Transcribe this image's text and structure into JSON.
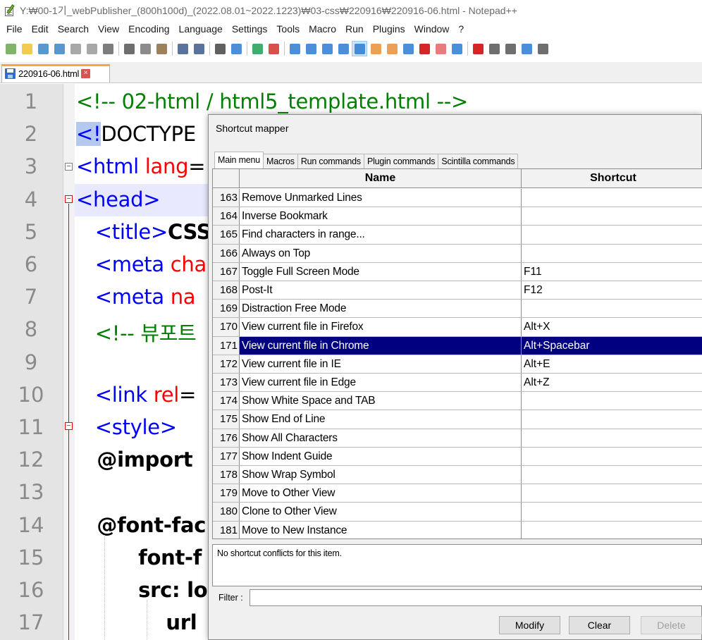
{
  "window": {
    "title": "Y:₩00-1기_webPublisher_(800h100d)_(2022.08.01~2022.1223)₩03-css₩220916₩220916-06.html - Notepad++"
  },
  "menubar": {
    "items": [
      "File",
      "Edit",
      "Search",
      "View",
      "Encoding",
      "Language",
      "Settings",
      "Tools",
      "Macro",
      "Run",
      "Plugins",
      "Window",
      "?"
    ]
  },
  "toolbar": {
    "icons": [
      {
        "name": "new-file-icon",
        "color": "#6aa84f"
      },
      {
        "name": "open-file-icon",
        "color": "#f1c232"
      },
      {
        "name": "save-icon",
        "color": "#3d85c6"
      },
      {
        "name": "save-all-icon",
        "color": "#3d85c6"
      },
      {
        "name": "close-icon",
        "color": "#999999"
      },
      {
        "name": "close-all-icon",
        "color": "#999999"
      },
      {
        "name": "print-icon",
        "color": "#666666"
      },
      {
        "name": "cut-icon",
        "color": "#555555"
      },
      {
        "name": "copy-icon",
        "color": "#777777"
      },
      {
        "name": "paste-icon",
        "color": "#8b6b3d"
      },
      {
        "name": "undo-icon",
        "color": "#3d5a8c"
      },
      {
        "name": "redo-icon",
        "color": "#3d5a8c"
      },
      {
        "name": "find-icon",
        "color": "#444444"
      },
      {
        "name": "replace-icon",
        "color": "#2d7bd1"
      },
      {
        "name": "zoom-in-icon",
        "color": "#1f9d55"
      },
      {
        "name": "zoom-out-icon",
        "color": "#d1302d"
      },
      {
        "name": "sync-vertical-icon",
        "color": "#2d7bd1"
      },
      {
        "name": "sync-horizontal-icon",
        "color": "#2d7bd1"
      },
      {
        "name": "word-wrap-icon",
        "color": "#2d7bd1"
      },
      {
        "name": "show-all-characters-icon",
        "color": "#2d7bd1"
      },
      {
        "name": "indent-guide-icon",
        "color": "#2d7bd1"
      },
      {
        "name": "language-define-icon",
        "color": "#e69138"
      },
      {
        "name": "document-map-icon",
        "color": "#e69138"
      },
      {
        "name": "document-list-icon",
        "color": "#2d7bd1"
      },
      {
        "name": "function-list-icon",
        "color": "#cc0000"
      },
      {
        "name": "folder-as-workspace-icon",
        "color": "#e06666"
      },
      {
        "name": "monitoring-icon",
        "color": "#2d7bd1"
      },
      {
        "name": "record-macro-icon",
        "color": "#cc0000"
      },
      {
        "name": "stop-recording-icon",
        "color": "#555555"
      },
      {
        "name": "playback-macro-icon",
        "color": "#555555"
      },
      {
        "name": "run-macro-multiple-icon",
        "color": "#2d7bd1"
      },
      {
        "name": "save-macro-icon",
        "color": "#555555"
      }
    ]
  },
  "tab": {
    "label": "220916-06.html",
    "close": "×"
  },
  "editor": {
    "lines": [
      {
        "num": "1",
        "parts": [
          {
            "t": "<!-- 02-html / html5_template.html -->",
            "c": "c-comment"
          }
        ]
      },
      {
        "num": "2",
        "parts": [
          {
            "t": "<!",
            "c": "c-tag sel-lt"
          },
          {
            "t": "DOCTYPE",
            "c": "c-black"
          }
        ]
      },
      {
        "num": "3",
        "parts": [
          {
            "t": "<html ",
            "c": "c-tag"
          },
          {
            "t": "lang",
            "c": "c-attr"
          },
          {
            "t": "=",
            "c": "c-black"
          }
        ]
      },
      {
        "num": "4",
        "parts": [
          {
            "t": "<head>",
            "c": "c-tag"
          }
        ]
      },
      {
        "num": "5",
        "parts": [
          {
            "t": "   <title>",
            "c": "c-tag"
          },
          {
            "t": "CSS",
            "c": "c-bold"
          }
        ]
      },
      {
        "num": "6",
        "parts": [
          {
            "t": "   <meta ",
            "c": "c-tag"
          },
          {
            "t": "cha",
            "c": "c-attr"
          }
        ]
      },
      {
        "num": "7",
        "parts": [
          {
            "t": "   <meta ",
            "c": "c-tag"
          },
          {
            "t": "na",
            "c": "c-attr"
          }
        ]
      },
      {
        "num": "8",
        "parts": [
          {
            "t": "   <!-- 뷰포트",
            "c": "c-comment"
          }
        ]
      },
      {
        "num": "9",
        "parts": []
      },
      {
        "num": "10",
        "parts": [
          {
            "t": "   <link ",
            "c": "c-tag"
          },
          {
            "t": "rel",
            "c": "c-attr"
          },
          {
            "t": "=",
            "c": "c-black"
          }
        ]
      },
      {
        "num": "11",
        "parts": [
          {
            "t": "   <style>",
            "c": "c-tag"
          }
        ]
      },
      {
        "num": "12",
        "parts": [
          {
            "t": "   @import",
            "c": "c-bold"
          }
        ]
      },
      {
        "num": "13",
        "parts": []
      },
      {
        "num": "14",
        "parts": [
          {
            "t": "   @font-fac",
            "c": "c-bold"
          }
        ]
      },
      {
        "num": "15",
        "parts": [
          {
            "t": "         font-f",
            "c": "c-bold"
          }
        ]
      },
      {
        "num": "16",
        "parts": [
          {
            "t": "         src: lo",
            "c": "c-bold"
          }
        ]
      },
      {
        "num": "17",
        "parts": [
          {
            "t": "             url",
            "c": "c-bold"
          }
        ]
      }
    ]
  },
  "dialog": {
    "title": "Shortcut mapper",
    "tabs": [
      "Main menu",
      "Macros",
      "Run commands",
      "Plugin commands",
      "Scintilla commands"
    ],
    "active_tab": 0,
    "columns": {
      "name": "Name",
      "shortcut": "Shortcut"
    },
    "rows": [
      {
        "num": "163",
        "name": "Remove Unmarked Lines",
        "shortcut": ""
      },
      {
        "num": "164",
        "name": "Inverse Bookmark",
        "shortcut": ""
      },
      {
        "num": "165",
        "name": "Find characters in range...",
        "shortcut": ""
      },
      {
        "num": "166",
        "name": "Always on Top",
        "shortcut": ""
      },
      {
        "num": "167",
        "name": "Toggle Full Screen Mode",
        "shortcut": "F11"
      },
      {
        "num": "168",
        "name": "Post-It",
        "shortcut": "F12"
      },
      {
        "num": "169",
        "name": "Distraction Free Mode",
        "shortcut": ""
      },
      {
        "num": "170",
        "name": "View current file in Firefox",
        "shortcut": "Alt+X"
      },
      {
        "num": "171",
        "name": "View current file in Chrome",
        "shortcut": "Alt+Spacebar",
        "selected": true
      },
      {
        "num": "172",
        "name": "View current file in IE",
        "shortcut": "Alt+E"
      },
      {
        "num": "173",
        "name": "View current file in Edge",
        "shortcut": "Alt+Z"
      },
      {
        "num": "174",
        "name": "Show White Space and TAB",
        "shortcut": ""
      },
      {
        "num": "175",
        "name": "Show End of Line",
        "shortcut": ""
      },
      {
        "num": "176",
        "name": "Show All Characters",
        "shortcut": ""
      },
      {
        "num": "177",
        "name": "Show Indent Guide",
        "shortcut": ""
      },
      {
        "num": "178",
        "name": "Show Wrap Symbol",
        "shortcut": ""
      },
      {
        "num": "179",
        "name": "Move to Other View",
        "shortcut": ""
      },
      {
        "num": "180",
        "name": "Clone to Other View",
        "shortcut": ""
      },
      {
        "num": "181",
        "name": "Move to New Instance",
        "shortcut": ""
      }
    ],
    "conflict_text": "No shortcut conflicts for this item.",
    "filter_label": "Filter :",
    "filter_value": "",
    "buttons": {
      "modify": "Modify",
      "clear": "Clear",
      "delete": "Delete"
    }
  }
}
